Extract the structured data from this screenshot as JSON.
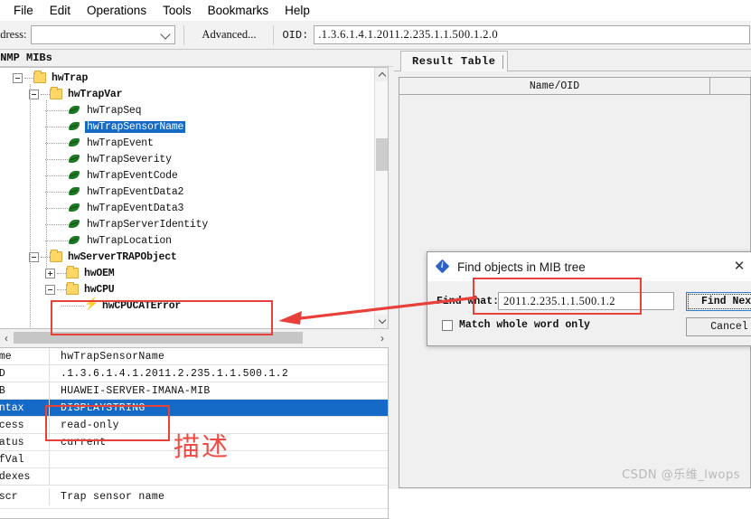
{
  "menubar": {
    "items": [
      {
        "label": "File"
      },
      {
        "label": "Edit"
      },
      {
        "label": "Operations"
      },
      {
        "label": "Tools"
      },
      {
        "label": "Bookmarks"
      },
      {
        "label": "Help"
      }
    ]
  },
  "toolbar": {
    "address_label": "ddress:",
    "address_value": "",
    "address_placeholder": "",
    "advanced_label": "Advanced...",
    "oid_label": "OID:",
    "oid_value": ".1.3.6.1.4.1.2011.2.235.1.1.500.1.2.0"
  },
  "left_panel": {
    "header": "SNMP MIBs",
    "tree": [
      {
        "label": "hwTrap",
        "depth": 1,
        "icon": "folder",
        "toggle": "minus",
        "bold": true,
        "selected": false
      },
      {
        "label": "hwTrapVar",
        "depth": 2,
        "icon": "folder",
        "toggle": "minus",
        "bold": true,
        "selected": false
      },
      {
        "label": "hwTrapSeq",
        "depth": 3,
        "icon": "leaf",
        "toggle": "none",
        "bold": false,
        "selected": false
      },
      {
        "label": "hwTrapSensorName",
        "depth": 3,
        "icon": "leaf",
        "toggle": "none",
        "bold": false,
        "selected": true
      },
      {
        "label": "hwTrapEvent",
        "depth": 3,
        "icon": "leaf",
        "toggle": "none",
        "bold": false,
        "selected": false
      },
      {
        "label": "hwTrapSeverity",
        "depth": 3,
        "icon": "leaf",
        "toggle": "none",
        "bold": false,
        "selected": false
      },
      {
        "label": "hwTrapEventCode",
        "depth": 3,
        "icon": "leaf",
        "toggle": "none",
        "bold": false,
        "selected": false
      },
      {
        "label": "hwTrapEventData2",
        "depth": 3,
        "icon": "leaf",
        "toggle": "none",
        "bold": false,
        "selected": false
      },
      {
        "label": "hwTrapEventData3",
        "depth": 3,
        "icon": "leaf",
        "toggle": "none",
        "bold": false,
        "selected": false
      },
      {
        "label": "hwTrapServerIdentity",
        "depth": 3,
        "icon": "leaf",
        "toggle": "none",
        "bold": false,
        "selected": false
      },
      {
        "label": "hwTrapLocation",
        "depth": 3,
        "icon": "leaf",
        "toggle": "none",
        "bold": false,
        "selected": false
      },
      {
        "label": "hwServerTRAPObject",
        "depth": 2,
        "icon": "folder",
        "toggle": "minus",
        "bold": true,
        "selected": false
      },
      {
        "label": "hwOEM",
        "depth": 3,
        "icon": "folder",
        "toggle": "plus",
        "bold": true,
        "selected": false
      },
      {
        "label": "hwCPU",
        "depth": 3,
        "icon": "folder",
        "toggle": "minus",
        "bold": true,
        "selected": false
      },
      {
        "label": "hwCPUCATError",
        "depth": 4,
        "icon": "bolt",
        "toggle": "none",
        "bold": true,
        "selected": false
      }
    ],
    "properties": [
      {
        "key": "ame",
        "value": "hwTrapSensorName",
        "highlight": false
      },
      {
        "key": "ID",
        "value": ".1.3.6.1.4.1.2011.2.235.1.1.500.1.2",
        "highlight": false
      },
      {
        "key": "IB",
        "value": "HUAWEI-SERVER-IMANA-MIB",
        "highlight": false
      },
      {
        "key": "yntax",
        "value": "DISPLAYSTRING",
        "highlight": true
      },
      {
        "key": "ccess",
        "value": "read-only",
        "highlight": false
      },
      {
        "key": "tatus",
        "value": "current",
        "highlight": false
      },
      {
        "key": "efVal",
        "value": "",
        "highlight": false
      },
      {
        "key": "ndexes",
        "value": "",
        "highlight": false
      },
      {
        "key": "escr",
        "value": "Trap sensor name",
        "highlight": false
      }
    ]
  },
  "right_panel": {
    "tab_label": "Result Table",
    "columns": [
      "Name/OID",
      ""
    ],
    "rows": []
  },
  "dialog": {
    "title": "Find objects in MIB tree",
    "close_label": "✕",
    "find_what_label": "Find what:",
    "find_what_value": "2011.2.235.1.1.500.1.2",
    "match_whole_word_label": "Match whole word only",
    "match_whole_word_checked": false,
    "find_next_label": "Find Next",
    "cancel_label": "Cancel"
  },
  "annotations": {
    "description_text": "描述",
    "accent_color": "#e8413a"
  },
  "watermark": {
    "text": "CSDN @乐维_lwops"
  }
}
